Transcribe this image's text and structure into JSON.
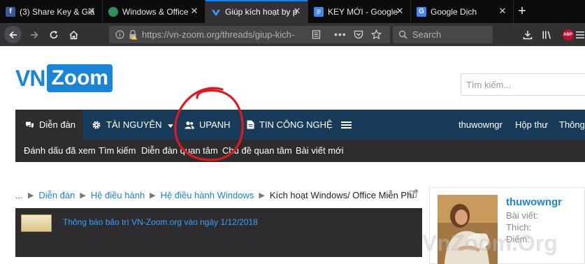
{
  "browser": {
    "tabs": [
      {
        "label": "(3) Share Key & Giả",
        "favicon": "facebook-icon",
        "active": false
      },
      {
        "label": "Windows & Office",
        "favicon": "globe-icon",
        "active": false
      },
      {
        "label": "Giúp kích hoạt by p",
        "favicon": "vnzoom-icon",
        "active": true
      },
      {
        "label": "KEY MỚI - Google",
        "favicon": "google-docs-icon",
        "active": false
      },
      {
        "label": "Google Dịch",
        "favicon": "google-translate-icon",
        "active": false
      }
    ],
    "url": "https://vn-zoom.org/threads/giup-kich-",
    "search_placeholder": "Search",
    "adblock_label": "ABP"
  },
  "site": {
    "logo_vn": "VN",
    "logo_zoom": "Zoom",
    "search_placeholder": "Tìm kiếm...",
    "nav": {
      "forum": "Diễn đàn",
      "resources": "TÀI NGUYÊN",
      "upanh": "UPANH",
      "tech_news": "TIN CÔNG NGHỆ",
      "username": "thuwowngr",
      "inbox": "Hộp thư",
      "notifications": "Thông"
    },
    "subnav": [
      "Đánh dấu đã xem",
      "Tìm kiếm",
      "Diễn đàn quan tâm",
      "Chủ đề quan tâm",
      "Bài viết mới"
    ],
    "breadcrumb": {
      "ellipsis": "...",
      "items": [
        "Diễn đàn",
        "Hệ điều hành",
        "Hệ điều hành Windows"
      ],
      "current": "Kích hoạt Windows/ Office Miễn Phí"
    },
    "notice": "Thông báo bảo trì VN-Zoom.org vào ngày 1/12/2018",
    "user_card": {
      "name": "thuwowngr",
      "posts_label": "Bài viết:",
      "likes_label": "Thích:",
      "points_label": "Điểm:"
    },
    "watermark": "VnZoom.Org"
  },
  "colors": {
    "accent": "#1a84d6",
    "nav_bg": "#183b5a",
    "subnav_bg": "#2d2d30",
    "annotation": "#e0191f"
  }
}
